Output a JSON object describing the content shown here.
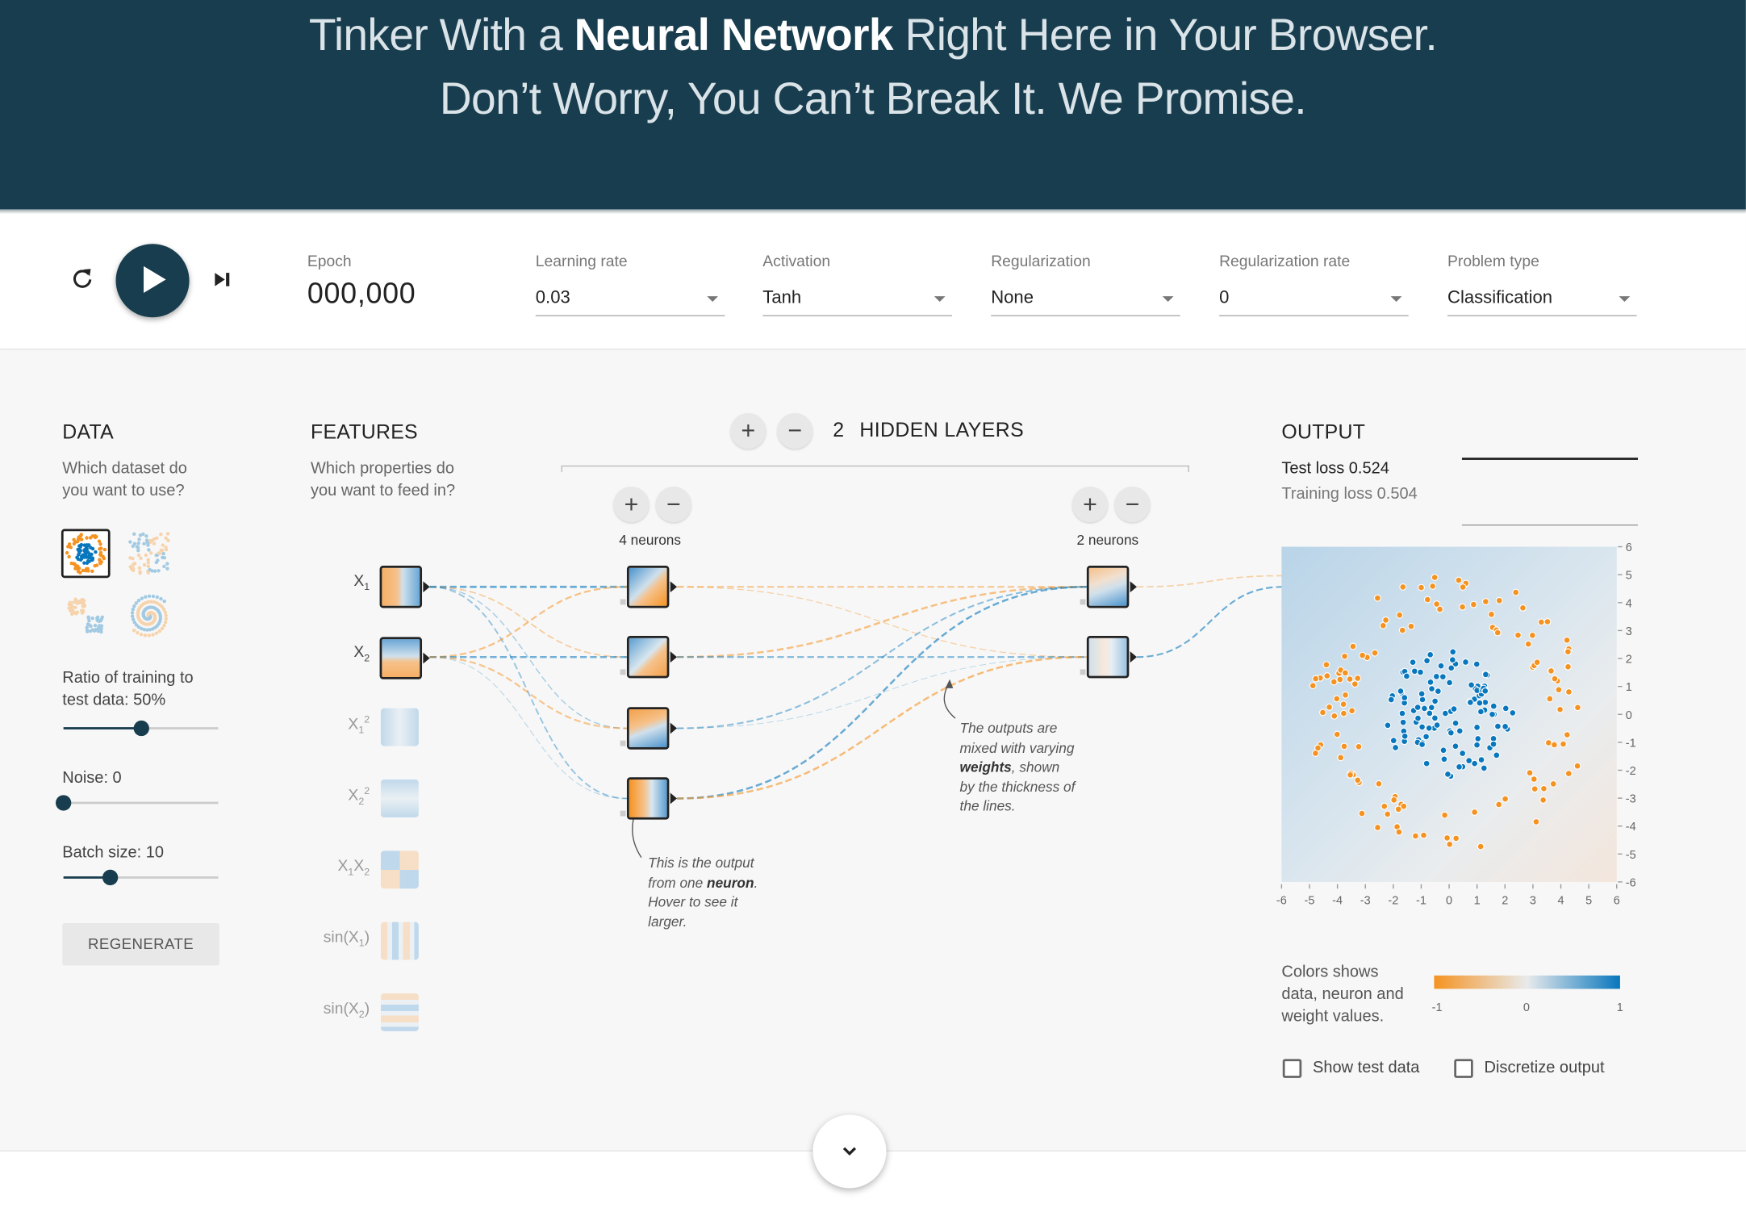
{
  "header": {
    "line1_pre": "Tinker With a ",
    "line1_bold": "Neural Network",
    "line1_post": " Right Here in Your Browser.",
    "line2": "Don’t Worry, You Can’t Break It. We Promise."
  },
  "controls": {
    "epoch_label": "Epoch",
    "epoch_value": "000,000",
    "learning_rate": {
      "label": "Learning rate",
      "value": "0.03"
    },
    "activation": {
      "label": "Activation",
      "value": "Tanh"
    },
    "regularization": {
      "label": "Regularization",
      "value": "None"
    },
    "regularization_rate": {
      "label": "Regularization rate",
      "value": "0"
    },
    "problem_type": {
      "label": "Problem type",
      "value": "Classification"
    },
    "icons": {
      "reset": "reset-icon",
      "play": "play-icon",
      "step": "step-forward-icon"
    }
  },
  "data_panel": {
    "title": "DATA",
    "subtitle_1": "Which dataset do",
    "subtitle_2": "you want to use?",
    "ratio_label_1": "Ratio of training to",
    "ratio_label_2": "test data:  50%",
    "ratio_value": 0.5,
    "noise_label": "Noise:  0",
    "noise_value": 0,
    "batch_label": "Batch size:  10",
    "batch_value": 0.3,
    "regenerate": "REGENERATE"
  },
  "features_panel": {
    "title": "FEATURES",
    "subtitle_1": "Which properties do",
    "subtitle_2": "you want to feed in?",
    "features": [
      {
        "base": "X",
        "sub": "1",
        "sup": "",
        "pre": "",
        "post": "",
        "active": true
      },
      {
        "base": "X",
        "sub": "2",
        "sup": "",
        "pre": "",
        "post": "",
        "active": true
      },
      {
        "base": "X",
        "sub": "1",
        "sup": "2",
        "pre": "",
        "post": "",
        "active": false
      },
      {
        "base": "X",
        "sub": "2",
        "sup": "2",
        "pre": "",
        "post": "",
        "active": false
      },
      {
        "base": "X",
        "sub": "1",
        "sup": "",
        "pre": "",
        "post": "X",
        "sub2": "2",
        "active": false
      },
      {
        "base": "sin(X",
        "sub": "1",
        "sup": "",
        "pre": "",
        "post": ")",
        "active": false
      },
      {
        "base": "sin(X",
        "sub": "2",
        "sup": "",
        "pre": "",
        "post": ")",
        "active": false
      }
    ]
  },
  "network": {
    "layers_count": "2",
    "layers_label": "HIDDEN LAYERS",
    "layer1_neurons": "4 neurons",
    "layer2_neurons": "2 neurons",
    "note_neuron_1": "This is the output",
    "note_neuron_2_pre": "from one ",
    "note_neuron_2_bold": "neuron",
    "note_neuron_2_post": ".",
    "note_neuron_3": "Hover to see it",
    "note_neuron_4": "larger.",
    "note_weights_1": "The outputs are",
    "note_weights_2": "mixed with varying",
    "note_weights_3_bold": "weights",
    "note_weights_3_post": ", shown",
    "note_weights_4": "by the thickness of",
    "note_weights_5": "the lines."
  },
  "output_panel": {
    "title": "OUTPUT",
    "test_loss": "Test loss 0.524",
    "training_loss": "Training loss 0.504",
    "colors_label_1": "Colors shows",
    "colors_label_2": "data, neuron and",
    "colors_label_3": "weight values.",
    "scale_min": "-1",
    "scale_mid": "0",
    "scale_max": "1",
    "show_test_data": "Show test data",
    "discretize_output": "Discretize output",
    "colors": {
      "orange": "#f59322",
      "blue": "#0877bd",
      "neutral": "#e8eaeb"
    }
  },
  "chart_data": {
    "type": "scatter",
    "xlim": [
      -6,
      6
    ],
    "ylim": [
      -6,
      6
    ],
    "x_ticks": [
      "-6",
      "-5",
      "-4",
      "-3",
      "-2",
      "-1",
      "0",
      "1",
      "2",
      "3",
      "4",
      "5",
      "6"
    ],
    "y_ticks": [
      "6",
      "5",
      "4",
      "3",
      "2",
      "1",
      "0",
      "-1",
      "-2",
      "-3",
      "-4",
      "-5",
      "-6"
    ],
    "series": [
      {
        "values_description": "",
        "color": "#0877bd",
        "cluster": "inner",
        "radius_range": [
          0,
          2.3
        ],
        "count": 110
      },
      {
        "color": "#f59322",
        "cluster": "ring",
        "radius_range": [
          3.4,
          5.0
        ],
        "count": 120
      }
    ]
  }
}
